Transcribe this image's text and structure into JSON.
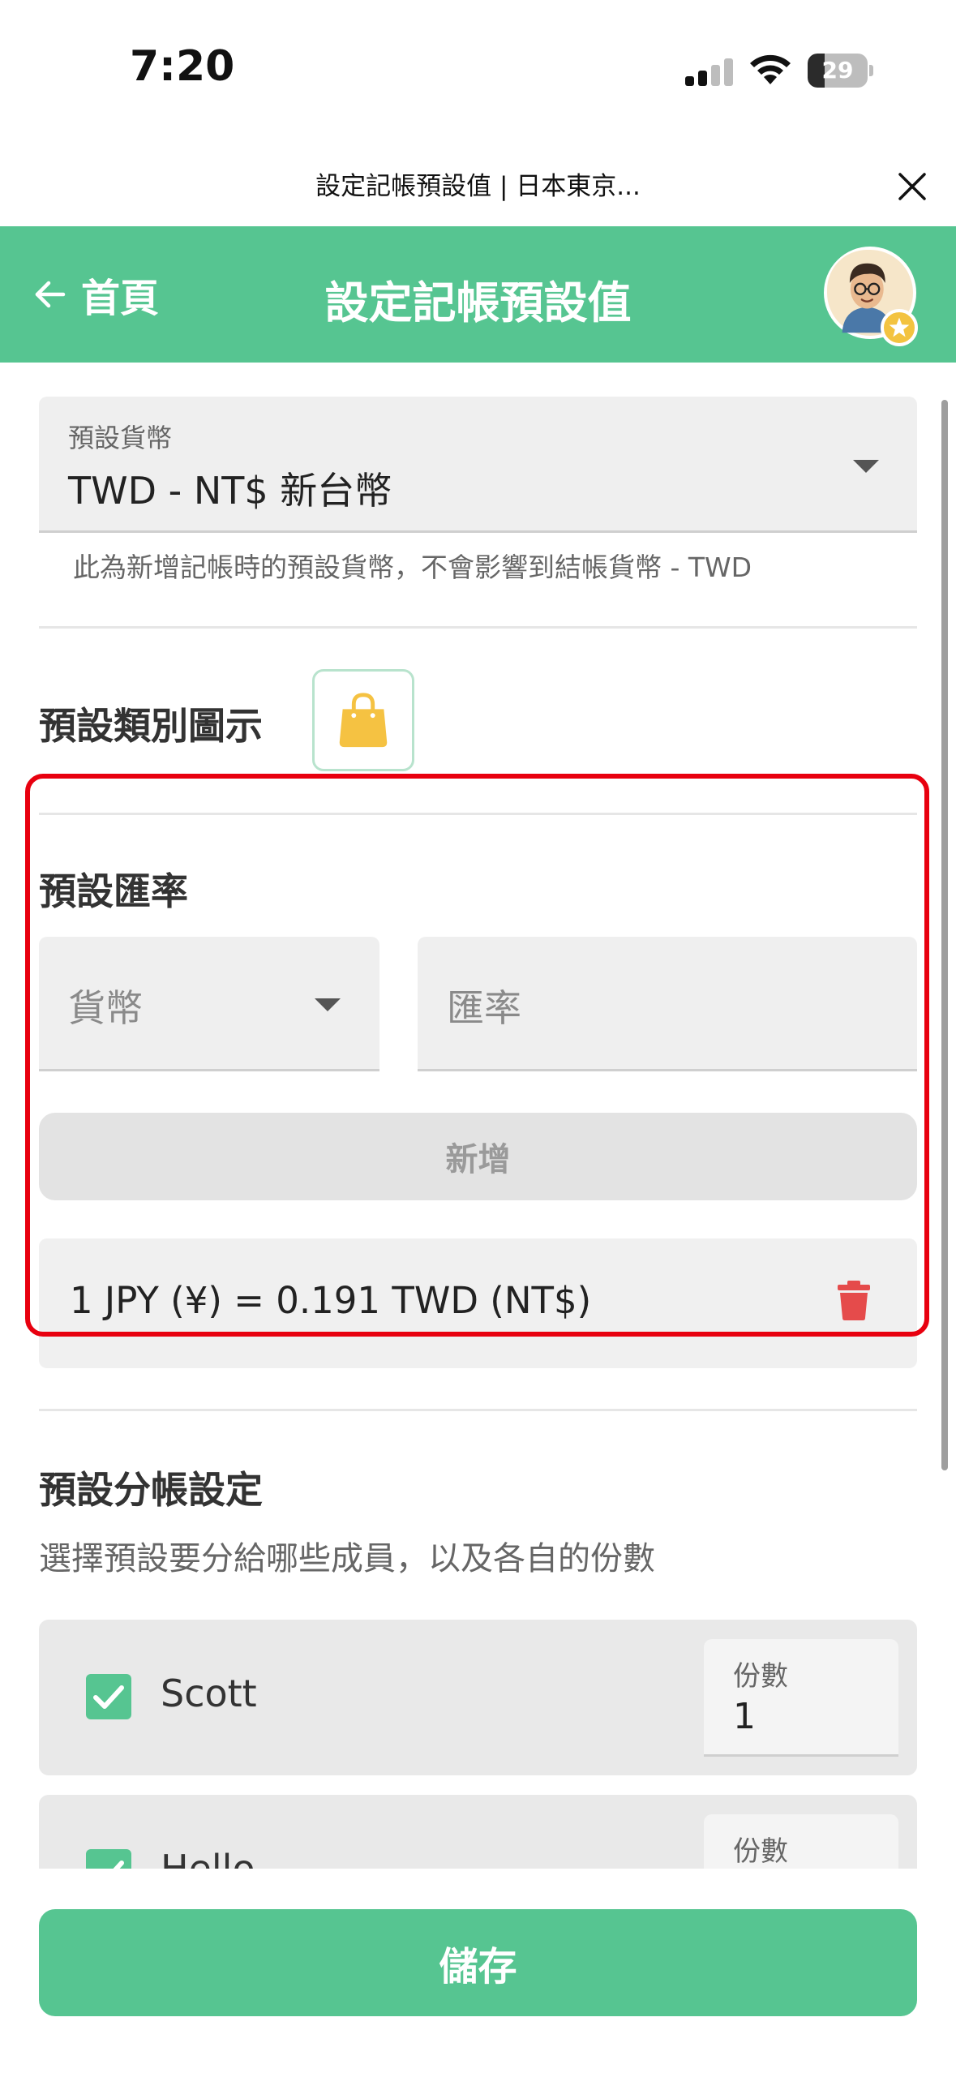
{
  "status_bar": {
    "time": "7:20",
    "battery": "29",
    "battery_level": 0.29
  },
  "browser": {
    "title": "設定記帳預設值 | 日本東京..."
  },
  "header": {
    "back_label": "首頁",
    "title": "設定記帳預設值"
  },
  "currency": {
    "label": "預設貨幣",
    "value": "TWD - NT$ 新台幣",
    "helper": "此為新增記帳時的預設貨幣，不會影響到結帳貨幣 - TWD"
  },
  "category_icon": {
    "title": "預設類別圖示",
    "icon": "shopping-bag-icon"
  },
  "exchange_rate": {
    "title": "預設匯率",
    "currency_placeholder": "貨幣",
    "rate_placeholder": "匯率",
    "add_label": "新增",
    "rates": [
      {
        "text": "1 JPY (¥) = 0.191 TWD (NT$)"
      }
    ]
  },
  "split": {
    "title": "預設分帳設定",
    "description": "選擇預設要分給哪些成員，以及各自的份數",
    "members": [
      {
        "name": "Scott",
        "checked": true,
        "share_label": "份數",
        "share": "1"
      },
      {
        "name": "Hello",
        "checked": true,
        "share_label": "份數",
        "share": ""
      }
    ]
  },
  "footer": {
    "save_label": "儲存"
  },
  "colors": {
    "brand": "#56c591",
    "highlight": "#e8000f",
    "delete": "#e54b4b",
    "icon_yellow": "#f5c242"
  }
}
